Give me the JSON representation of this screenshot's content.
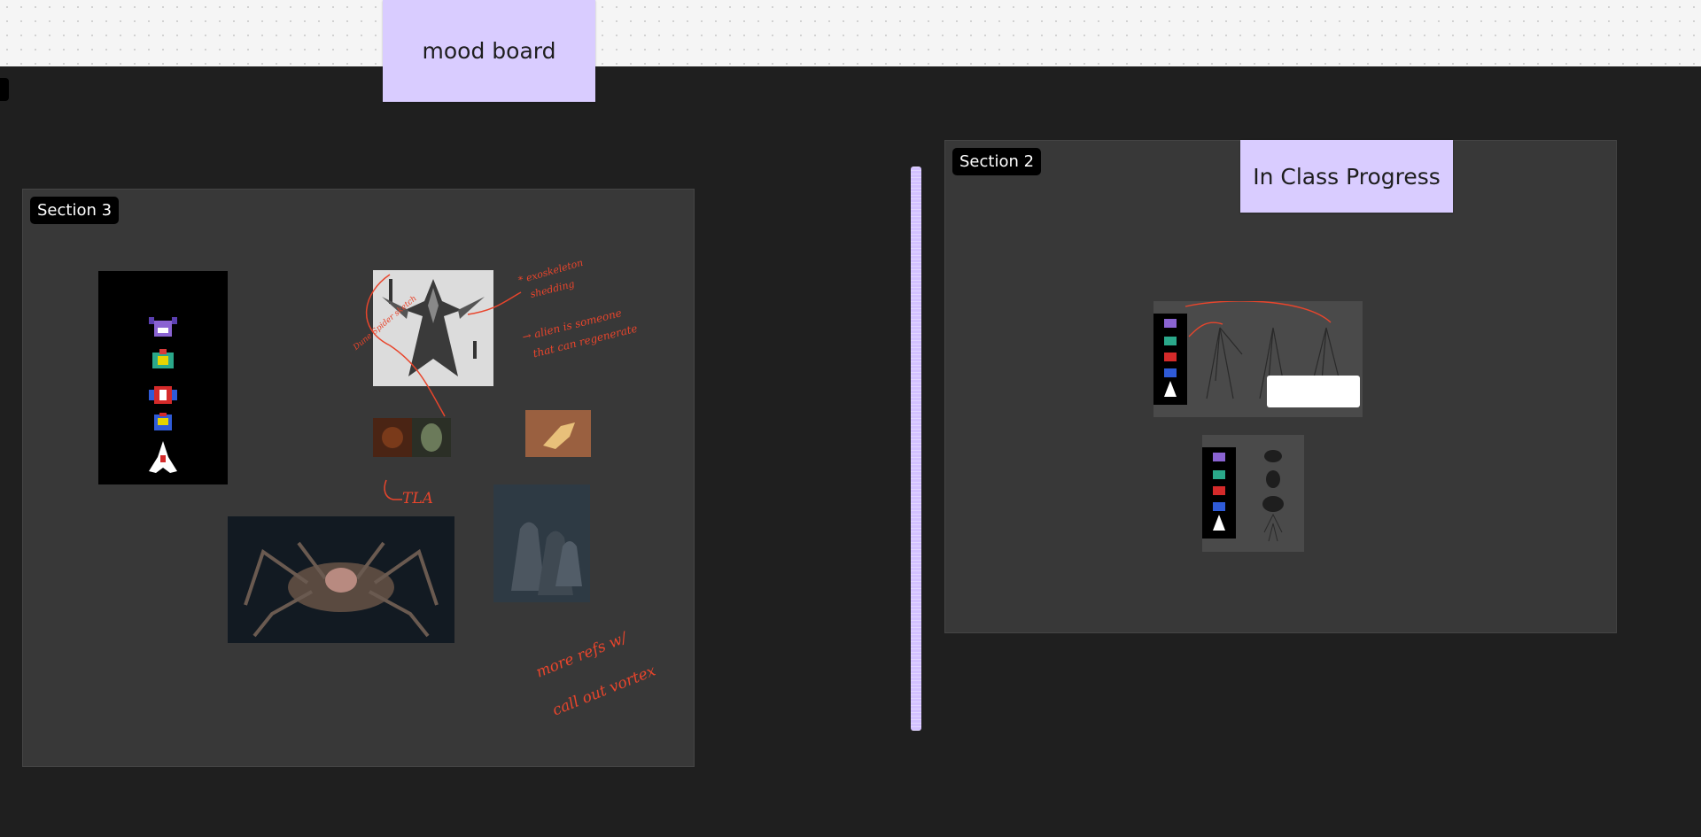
{
  "stickies": {
    "mood_board": "mood board",
    "in_class_progress": "In Class Progress"
  },
  "sections": {
    "section3_label": "Section 3",
    "section2_label": "Section 2"
  },
  "annotations": {
    "exoskeleton": "* exoskeleton",
    "shedding": "shedding",
    "alien_1": "→ alien is someone",
    "alien_2": "that can regenerate",
    "side_note": "Dune Spider sketch",
    "tla": "TLA",
    "refs_1": "more refs w/",
    "refs_2": "call out vortex"
  },
  "colors": {
    "canvas_dark": "#1f1f1f",
    "section_bg": "#383838",
    "sticky": "#d9ccff",
    "annotation": "#e8452c"
  }
}
